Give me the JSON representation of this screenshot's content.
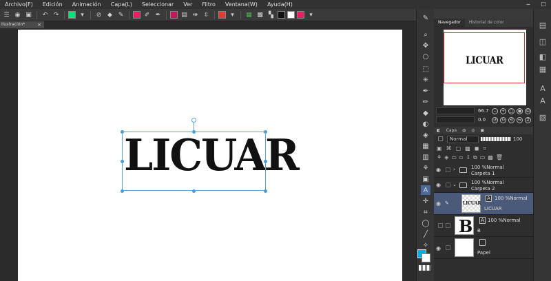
{
  "menubar": {
    "items": [
      "Archivo(F)",
      "Edición",
      "Animación",
      "Capa(L)",
      "Seleccionar",
      "Ver",
      "Filtro",
      "Ventana(W)",
      "Ayuda(H)"
    ]
  },
  "cmdbar": {
    "icons": [
      "menu-icon",
      "undo-icon",
      "redo-icon",
      "clear-icon",
      "eraser-icon",
      "eyedropper-icon",
      "layer-icon",
      "flip-icon"
    ],
    "swatch_colors": [
      "#00e676",
      "#e91e63",
      "#333333",
      "#ffffff",
      "#e91e63"
    ]
  },
  "doc_tab": {
    "label": "Ilustración*",
    "close": "×"
  },
  "canvas": {
    "text": "LICUAR"
  },
  "navigator": {
    "tabs": [
      "Navegador",
      "Historial de color"
    ],
    "preview_text": "LICUAR",
    "zoom": "66.7",
    "rotation": "0.0"
  },
  "colors": {
    "main": "#00aeef",
    "sub": "#ffffff"
  },
  "layers_panel": {
    "tab_label": "Capa",
    "blend_mode": "Normal",
    "opacity": "100",
    "layers": [
      {
        "mode": "100 %Normal",
        "name": "Carpeta 1",
        "type": "folder"
      },
      {
        "mode": "100 %Normal",
        "name": "Carpeta 2",
        "type": "folder"
      },
      {
        "mode": "100 %Normal",
        "name": "LICUAR",
        "type": "text",
        "thumb_text": "LICUAR",
        "selected": true
      },
      {
        "mode": "100 %Normal",
        "name": "B",
        "type": "text",
        "thumb_text": "B"
      },
      {
        "mode": "",
        "name": "Papel",
        "type": "paper"
      }
    ]
  }
}
